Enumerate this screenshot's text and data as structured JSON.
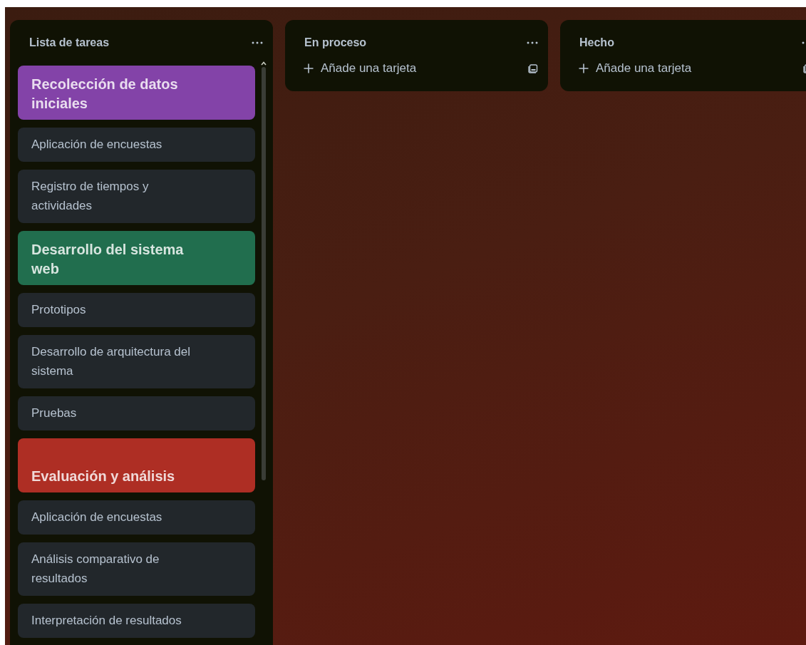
{
  "columns": [
    {
      "title": "Lista de tareas",
      "cards": [
        {
          "kind": "cover",
          "color": "#8343a8",
          "text": "Recolección de datos iniciales"
        },
        {
          "kind": "task",
          "text": "Aplicación de encuestas"
        },
        {
          "kind": "task",
          "text": "Registro de tiempos y actividades"
        },
        {
          "kind": "cover",
          "color": "#216e4e",
          "text": "Desarrollo del sistema web"
        },
        {
          "kind": "task",
          "text": "Prototipos"
        },
        {
          "kind": "task",
          "text": "Desarrollo de arquitectura del sistema"
        },
        {
          "kind": "task",
          "text": "Pruebas"
        },
        {
          "kind": "cover",
          "color": "#ae2e24",
          "text": "Evaluación y análisis"
        },
        {
          "kind": "task",
          "text": "Aplicación de encuestas"
        },
        {
          "kind": "task",
          "text": "Análisis comparativo de resultados"
        },
        {
          "kind": "task",
          "text": "Interpretación de resultados"
        }
      ]
    },
    {
      "title": "En proceso",
      "add_card": "Añade una tarjeta"
    },
    {
      "title": "Hecho",
      "add_card": "Añade una tarjeta"
    }
  ]
}
